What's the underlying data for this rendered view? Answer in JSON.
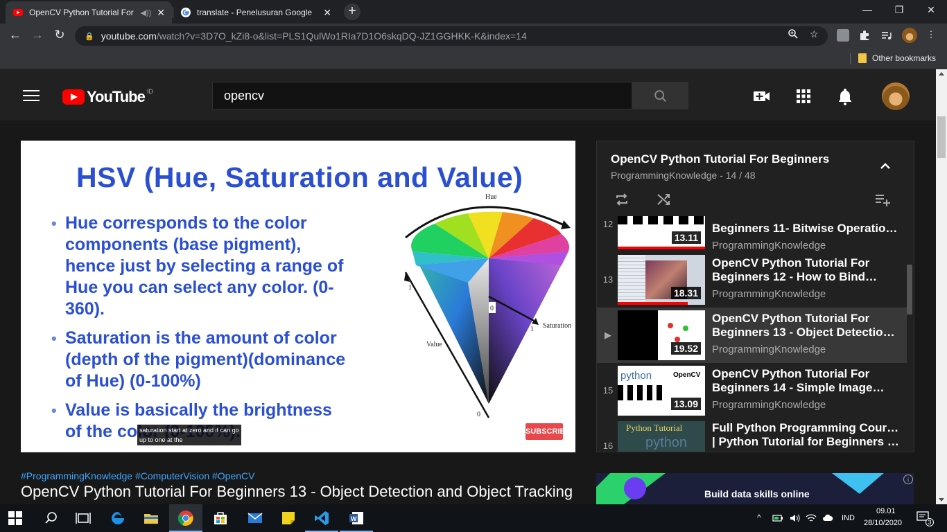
{
  "browser": {
    "tabs": [
      {
        "title": "OpenCV Python Tutorial For",
        "favicon": "youtube-favicon",
        "active": true,
        "audio": true
      },
      {
        "title": "translate - Penelusuran Google",
        "favicon": "google-favicon",
        "active": false
      }
    ],
    "url_host": "youtube.com",
    "url_path": "/watch?v=3D7O_kZi8-o&list=PLS1QulWo1RIa7D1O6skqDQ-JZ1GGHKK-K&index=14",
    "bookmarks_label": "Other bookmarks"
  },
  "youtube": {
    "country_code": "ID",
    "search_value": "opencv",
    "brand_color": "#ff0000",
    "video": {
      "slide_title": "HSV (Hue, Saturation and Value)",
      "bullet1": [
        "Hue corresponds to the color",
        "components (base pigment),",
        "hence just by selecting a range of",
        "Hue you can select any color. (0-",
        "360)."
      ],
      "bullet2": [
        "Saturation is the amount of color",
        "(depth of the pigment)(dominance",
        "of Hue) (0-100%)"
      ],
      "bullet3": [
        "Value is basically the brightness",
        "of the color (0-100%)."
      ],
      "diagram_labels": {
        "hue": "Hue",
        "saturation": "Saturation",
        "value": "Value",
        "one_a": "1",
        "one_b": "1",
        "zero_a": "0",
        "zero_b": "0"
      },
      "caption_line1": "saturation start at zero and it can go",
      "caption_line2": "up to one at the",
      "subscribe_badge": "SUBSCRIBE"
    },
    "hashtags": "#ProgrammingKnowledge #ComputerVision #OpenCV",
    "title": "OpenCV Python Tutorial For Beginners 13 - Object Detection and Object Tracking",
    "playlist": {
      "title": "OpenCV Python Tutorial For Beginners",
      "subtitle": "ProgrammingKnowledge - 14 / 48",
      "items": [
        {
          "index": "12",
          "title1": "Beginners 11- Bitwise Operatio…",
          "title2": "",
          "channel": "ProgrammingKnowledge",
          "duration": "13.11",
          "watched": 1.0
        },
        {
          "index": "13",
          "title1": "OpenCV Python Tutorial For",
          "title2": "Beginners 12 - How to Bind…",
          "channel": "ProgrammingKnowledge",
          "duration": "18.31",
          "watched": 0.8
        },
        {
          "index": "▶",
          "title1": "OpenCV Python Tutorial For",
          "title2": "Beginners 13 - Object Detection…",
          "channel": "ProgrammingKnowledge",
          "duration": "19.52",
          "watched": 0.0
        },
        {
          "index": "15",
          "title1": "OpenCV Python Tutorial For",
          "title2": "Beginners 14 - Simple Image…",
          "channel": "ProgrammingKnowledge",
          "duration": "13.09",
          "watched": 0.0
        },
        {
          "index": "16",
          "title1": "Full Python Programming Course",
          "title2": "| Python Tutorial for Beginners |…",
          "channel": "",
          "duration": "",
          "watched": 0.0
        }
      ],
      "thumb_texts": {
        "python": "python",
        "opencv": "OpenCV",
        "python_tutorial": "Python Tutorial"
      }
    },
    "ad": {
      "text": "Build data skills online",
      "info": "i"
    }
  },
  "taskbar": {
    "language": "IND",
    "time": "09.01",
    "date": "28/10/2020",
    "notifications": "3"
  }
}
